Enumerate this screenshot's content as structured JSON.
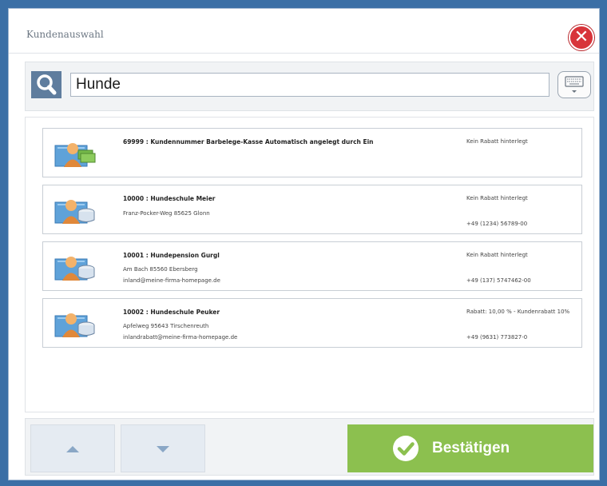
{
  "dialog": {
    "title": "Kundenauswahl"
  },
  "search": {
    "value": "Hunde"
  },
  "customers": [
    {
      "name": "69999 : Kundennummer Barbelege-Kasse Automatisch angelegt durch Ein",
      "line1": "",
      "line2": "",
      "discount": "Kein Rabatt hinterlegt",
      "phone": ""
    },
    {
      "name": "10000 : Hundeschule Meier",
      "line1": "Franz-Pocker-Weg 85625 Glonn",
      "line2": "",
      "discount": "Kein Rabatt hinterlegt",
      "phone": "+49 (1234) 56789-00"
    },
    {
      "name": "10001 : Hundepension Gurgl",
      "line1": "Am Bach 85560 Ebersberg",
      "line2": "inland@meine-firma-homepage.de",
      "discount": "Kein Rabatt hinterlegt",
      "phone": "+49 (137) 5747462-00"
    },
    {
      "name": "10002 : Hundeschule Peuker",
      "line1": "Apfelweg 95643 Tirschenreuth",
      "line2": "inlandrabatt@meine-firma-homepage.de",
      "discount": "Rabatt: 10,00 % - Kundenrabatt 10%",
      "phone": "+49 (9631) 773827-0"
    }
  ],
  "footer": {
    "confirm_label": "Bestätigen"
  },
  "colors": {
    "confirm": "#8cc04f",
    "close": "#d8343a",
    "search_icon_bg": "#5f7d9e"
  }
}
